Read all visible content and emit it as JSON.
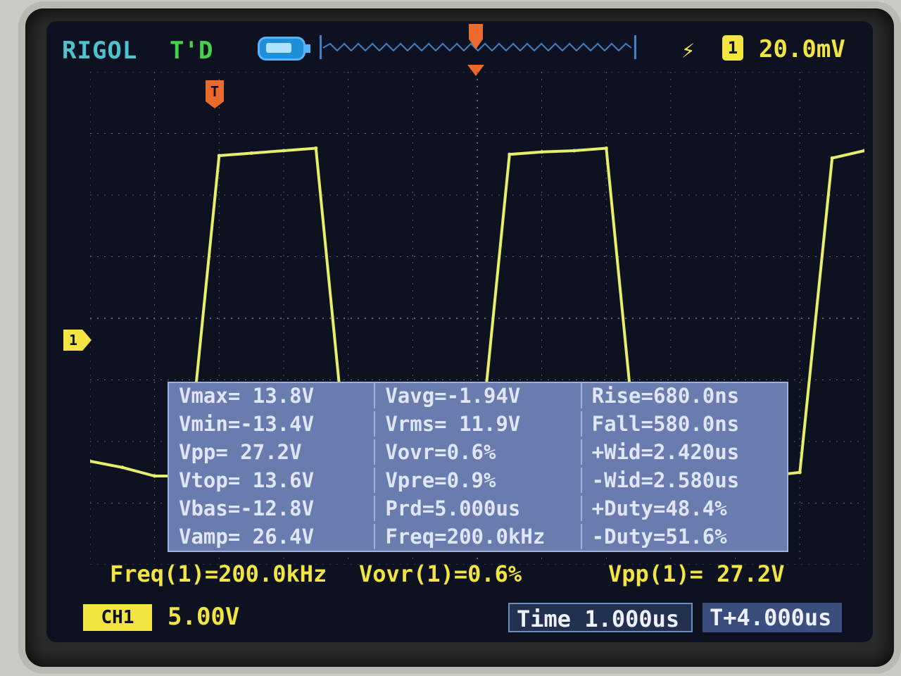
{
  "top_bar": {
    "brand": "RIGOL",
    "trigger_status": "T'D",
    "trigger_source_badge": "1",
    "trigger_edge_icon": "rising-edge-icon",
    "trigger_level": "20.0mV"
  },
  "markers": {
    "trigger_time_marker": "T",
    "ch1_ground_marker": "1"
  },
  "measurements": [
    [
      "Vmax= 13.8V",
      "Vavg=-1.94V",
      "Rise=680.0ns"
    ],
    [
      "Vmin=-13.4V",
      "Vrms= 11.9V",
      "Fall=580.0ns"
    ],
    [
      "Vpp= 27.2V",
      "Vovr=0.6%",
      "+Wid=2.420us"
    ],
    [
      "Vtop= 13.6V",
      "Vpre=0.9%",
      "-Wid=2.580us"
    ],
    [
      "Vbas=-12.8V",
      "Prd=5.000us",
      "+Duty=48.4%"
    ],
    [
      "Vamp= 26.4V",
      "Freq=200.0kHz",
      "-Duty=51.6%"
    ]
  ],
  "summary": {
    "freq": "Freq(1)=200.0kHz",
    "vovr": "Vovr(1)=0.6%",
    "vpp": "Vpp(1)= 27.2V"
  },
  "bottom_bar": {
    "ch1_badge": "CH1",
    "ch1_scale": "5.00V",
    "time_base": "Time 1.000us",
    "trigger_offset": "T+4.000us"
  },
  "chart_data": {
    "type": "line",
    "title": "",
    "xlabel": "",
    "ylabel": "",
    "grid": true,
    "xlim": [
      -2,
      10
    ],
    "ylim": [
      -20,
      20
    ],
    "x": [
      -2.0,
      -1.5,
      -1.0,
      -0.5,
      0.0,
      0.5,
      1.0,
      1.5,
      2.0,
      2.5,
      3.0,
      3.5,
      4.0,
      4.5,
      5.0,
      5.5,
      6.0,
      6.5,
      7.0,
      7.5,
      8.0,
      8.5,
      9.0,
      9.5,
      10.0
    ],
    "series": [
      {
        "values": [
          -11.6,
          -12.1,
          -12.8,
          -12.8,
          13.2,
          13.4,
          13.6,
          13.8,
          -12.8,
          -12.8,
          -12.8,
          -12.8,
          -12.8,
          13.3,
          13.5,
          13.6,
          13.8,
          -12.8,
          -12.8,
          -12.8,
          -12.8,
          -12.8,
          -12.5,
          13.0,
          13.6
        ]
      }
    ]
  }
}
